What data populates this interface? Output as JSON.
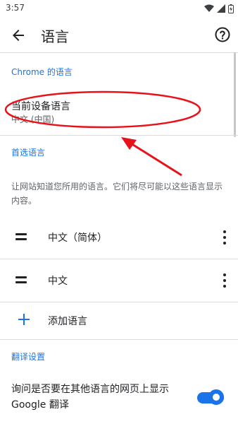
{
  "status_bar": {
    "time": "3:57",
    "icons": [
      "wifi-icon",
      "cell-signal-icon",
      "battery-icon"
    ]
  },
  "app_bar": {
    "title": "语言",
    "back_icon": "arrow-back-icon",
    "help_icon": "help-circle-icon"
  },
  "chrome_language": {
    "header": "Chrome 的语言",
    "item_title": "当前设备语言",
    "item_subtitle": "中文 (中国)"
  },
  "preferred_languages": {
    "header": "首选语言",
    "description": "让网站知道您所用的语言。它们将尽可能以这些语言显示内容。",
    "items": [
      {
        "label": "中文（简体）"
      },
      {
        "label": "中文"
      }
    ],
    "add_label": "添加语言"
  },
  "translate": {
    "header": "翻译设置",
    "ask_label": "询问是否要在其他语言的网页上显示 Google 翻译",
    "ask_enabled": true
  },
  "colors": {
    "accent": "#1a73e8",
    "annotation": "#e8121b",
    "divider": "#dadce0"
  }
}
